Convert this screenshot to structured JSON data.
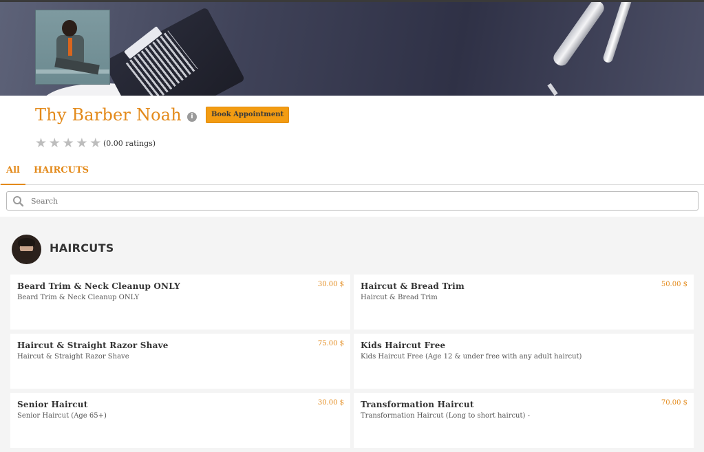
{
  "shop": {
    "name": "Thy Barber Noah",
    "book_label": "Book Appointment",
    "rating_text": "(0.00 ratings)",
    "rating_value": 0,
    "rating_max": 5
  },
  "tabs": [
    {
      "label": "All",
      "active": true
    },
    {
      "label": "HAIRCUTS",
      "active": false
    }
  ],
  "search": {
    "placeholder": "Search",
    "value": ""
  },
  "category": {
    "title": "HAIRCUTS",
    "services": [
      {
        "name": "Beard Trim & Neck Cleanup ONLY",
        "description": "Beard Trim & Neck Cleanup ONLY",
        "price": "30.00 $"
      },
      {
        "name": "Haircut & Bread Trim",
        "description": "Haircut & Bread Trim",
        "price": "50.00 $"
      },
      {
        "name": "Haircut & Straight Razor Shave",
        "description": "Haircut & Straight Razor Shave",
        "price": "75.00 $"
      },
      {
        "name": "Kids Haircut Free",
        "description": "Kids Haircut Free (Age 12 & under free with any adult haircut)",
        "price": ""
      },
      {
        "name": "Senior Haircut",
        "description": "Senior Haircut (Age 65+)",
        "price": "30.00 $"
      },
      {
        "name": "Transformation Haircut",
        "description": "Transformation Haircut (Long to short haircut) -",
        "price": "70.00 $"
      }
    ]
  },
  "colors": {
    "accent": "#e38a1b",
    "button": "#f39c12",
    "star_empty": "#bdbdbd"
  },
  "icons": {
    "info": "info-icon",
    "search": "search-icon",
    "star": "star-icon"
  }
}
